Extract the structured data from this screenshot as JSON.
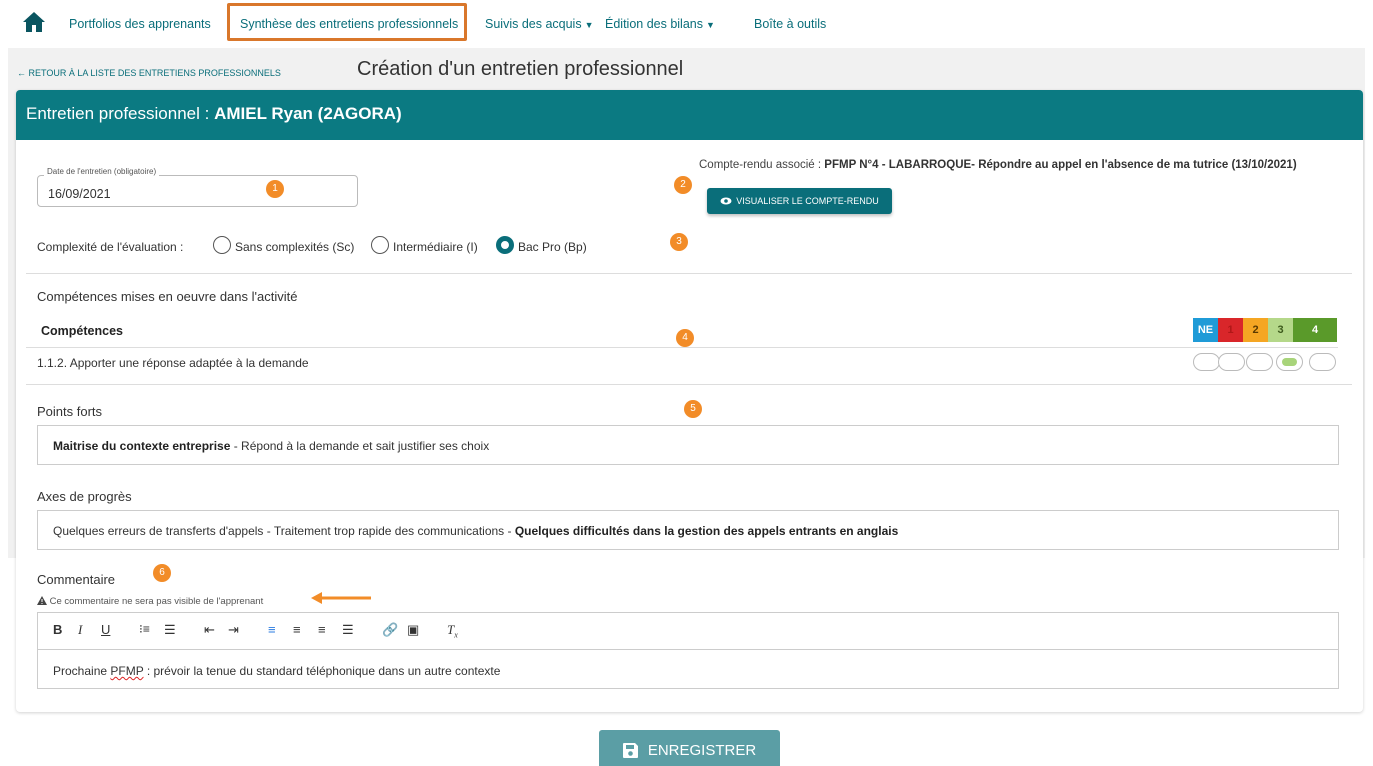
{
  "nav": {
    "items": [
      {
        "label": "Portfolios des apprenants"
      },
      {
        "label": "Synthèse des entretiens professionnels"
      },
      {
        "label": "Suivis des acquis"
      },
      {
        "label": "Édition des bilans"
      },
      {
        "label": "Boîte à outils"
      }
    ],
    "active_index": 1
  },
  "back_link": "← RETOUR À LA LISTE DES ENTRETIENS PROFESSIONNELS",
  "page_title": "Création d'un entretien professionnel",
  "card": {
    "title_prefix": "Entretien professionnel : ",
    "title_student": "AMIEL Ryan (2AGORA)"
  },
  "date": {
    "legend": "Date de l'entretien (obligatoire)",
    "value": "16/09/2021"
  },
  "compte_rendu": {
    "label": "Compte-rendu associé : ",
    "value": "PFMP N°4 - LABARROQUE- Répondre au appel en l'absence de ma tutrice (13/10/2021)",
    "button": "VISUALISER LE COMPTE-RENDU"
  },
  "complexity": {
    "label": "Complexité de l'évaluation :",
    "options": [
      {
        "label": "Sans complexités (Sc)",
        "checked": false
      },
      {
        "label": "Intermédiaire (I)",
        "checked": false
      },
      {
        "label": "Bac Pro (Bp)",
        "checked": true
      }
    ]
  },
  "competences": {
    "section_title": "Compétences mises en oeuvre dans l'activité",
    "header": "Compétences",
    "levels": [
      {
        "label": "NE",
        "color": "#1f9bd7"
      },
      {
        "label": "1",
        "color": "#d9262a"
      },
      {
        "label": "2",
        "color": "#f5a623"
      },
      {
        "label": "3",
        "color": "#b5d88a"
      },
      {
        "label": "4",
        "color": "#5a9a2a"
      }
    ],
    "rows": [
      {
        "label": "1.1.2. Apporter une réponse adaptée à la demande",
        "selected_level": "3"
      }
    ]
  },
  "points_forts": {
    "title": "Points forts",
    "bold": "Maitrise du contexte entreprise",
    "text": " - Répond à la demande et sait justifier ses choix"
  },
  "axes": {
    "title": "Axes de progrès",
    "text": "Quelques erreurs de transferts d'appels - Traitement trop rapide des communications - ",
    "bold": "Quelques difficultés dans la gestion des appels entrants en anglais"
  },
  "commentaire": {
    "title": "Commentaire",
    "notice": "Ce commentaire ne sera pas visible de l'apprenant",
    "body_prefix": "Prochaine ",
    "body_misspelled": "PFMP",
    "body_rest": " : prévoir la tenue du standard téléphonique dans un autre contexte"
  },
  "badges": [
    "1",
    "2",
    "3",
    "4",
    "5",
    "6"
  ],
  "save_button": "ENREGISTRER",
  "colors": {
    "teal": "#0b7a82",
    "orange": "#f28c28",
    "highlight_border": "#d9772b"
  }
}
